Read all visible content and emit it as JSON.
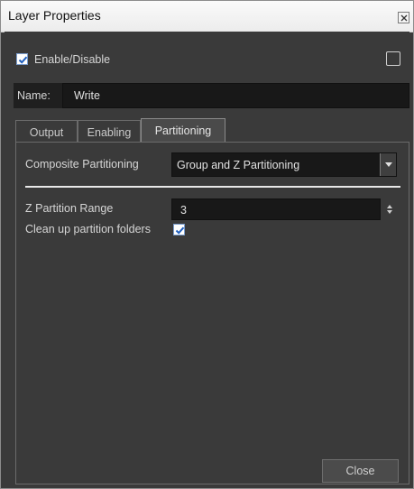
{
  "window": {
    "title": "Layer Properties"
  },
  "enable": {
    "label": "Enable/Disable",
    "checked": true
  },
  "name": {
    "label": "Name:",
    "value": "Write"
  },
  "tabs": [
    {
      "label": "Output",
      "active": false
    },
    {
      "label": "Enabling",
      "active": false
    },
    {
      "label": "Partitioning",
      "active": true
    }
  ],
  "partitioning": {
    "composite_label": "Composite Partitioning",
    "composite_value": "Group and Z Partitioning",
    "z_range_label": "Z Partition Range",
    "z_range_value": "3",
    "cleanup_label": "Clean up partition folders",
    "cleanup_checked": true
  },
  "footer": {
    "close_label": "Close"
  },
  "colors": {
    "background": "#3a3a3a",
    "field_background": "#181818",
    "checkbox_accent": "#1f5fbf"
  }
}
